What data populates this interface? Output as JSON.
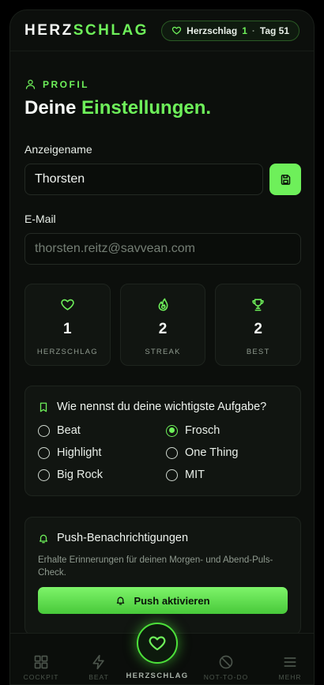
{
  "header": {
    "logo_part1": "HERZ",
    "logo_part2": "SCHLAG",
    "pill_label": "Herzschlag",
    "pill_count": "1",
    "pill_separator": "·",
    "pill_day": "Tag 51"
  },
  "profile": {
    "section_label": "PROFIL",
    "title_part1": "Deine",
    "title_part2": "Einstellungen.",
    "display_name_label": "Anzeigename",
    "display_name_value": "Thorsten",
    "email_label": "E-Mail",
    "email_value": "thorsten.reitz@savvean.com"
  },
  "stats": [
    {
      "icon": "heart-icon",
      "value": "1",
      "label": "HERZSCHLAG"
    },
    {
      "icon": "flame-icon",
      "value": "2",
      "label": "STREAK"
    },
    {
      "icon": "trophy-icon",
      "value": "2",
      "label": "BEST"
    }
  ],
  "task_naming": {
    "question": "Wie nennst du deine wichtigste Aufgabe?",
    "options": [
      {
        "label": "Beat",
        "selected": false
      },
      {
        "label": "Frosch",
        "selected": true
      },
      {
        "label": "Highlight",
        "selected": false
      },
      {
        "label": "One Thing",
        "selected": false
      },
      {
        "label": "Big Rock",
        "selected": false
      },
      {
        "label": "MIT",
        "selected": false
      }
    ]
  },
  "push": {
    "title": "Push-Benachrichtigungen",
    "description": "Erhalte Erinnerungen für deinen Morgen- und Abend-Puls-Check.",
    "button_label": "Push aktivieren"
  },
  "nav": {
    "cockpit": "COCKPIT",
    "beat": "BEAT",
    "herzschlag": "HERZSCHLAG",
    "not_to_do": "NOT-TO-DO",
    "more": "MEHR"
  },
  "colors": {
    "accent": "#6ef05a",
    "background": "#0c0f0c",
    "card": "#111511",
    "muted_text": "#8f9a8f"
  }
}
